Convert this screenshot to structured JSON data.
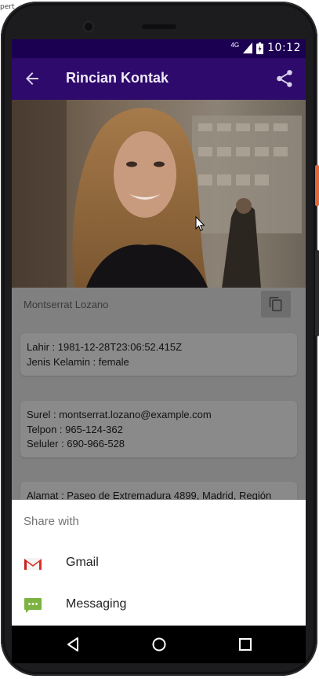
{
  "corner": {
    "text": "pert"
  },
  "statusbar": {
    "network": "4G",
    "time": "10:12"
  },
  "appbar": {
    "title": "Rincian Kontak",
    "color": "#2d0a6b"
  },
  "contact": {
    "name": "Montserrat Lozano",
    "birth": "Lahir : 1981-12-28T23:06:52.415Z",
    "gender": "Jenis Kelamin : female",
    "email": "Surel : montserrat.lozano@example.com",
    "phone": "Telpon : 965-124-362",
    "cell": "Seluler : 690-966-528",
    "address": "Alamat : Paseo de Extremadura 4899, Madrid, Región"
  },
  "share_sheet": {
    "title": "Share with",
    "items": [
      {
        "label": "Gmail",
        "icon": "gmail-icon"
      },
      {
        "label": "Messaging",
        "icon": "messaging-icon"
      }
    ]
  },
  "navbar": {
    "icons": [
      "back-triangle-icon",
      "home-circle-icon",
      "recent-square-icon"
    ]
  }
}
